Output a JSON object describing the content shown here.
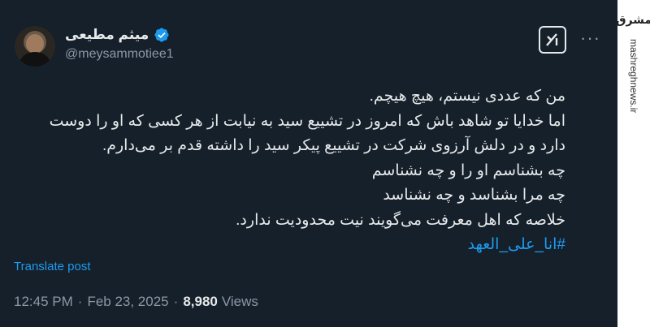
{
  "author": {
    "display_name": "میثم مطیعی",
    "handle": "@meysammotiee1"
  },
  "icons": {
    "verified": "verified-badge-icon",
    "grok": "grok-icon",
    "more": "more-options-icon",
    "avatar": "profile-avatar"
  },
  "tweet": {
    "lines": [
      "من که عددی نیستم، هیچ هیچم.",
      "اما خدایا تو شاهد باش که امروز در تشییع سید به نیابت از هر کسی که او را دوست",
      "دارد و در دلش آرزوی شرکت در تشییع پیکر سید را داشته قدم بر می‌دارم.",
      "چه بشناسم او را و چه نشناسم",
      "چه مرا بشناسد و چه نشناسد",
      "خلاصه که اهل معرفت می‌گویند نیت محدودیت ندارد."
    ],
    "hashtag": "#انا_علی_العهد"
  },
  "translate_label": "Translate post",
  "meta": {
    "time": "12:45 PM",
    "separator": "·",
    "date": "Feb 23, 2025",
    "views_count": "8,980",
    "views_label": "Views"
  },
  "watermark": {
    "logo": "مشرق",
    "site": "mashreghnews.ir"
  },
  "colors": {
    "background": "#15202b",
    "text": "#e7e9ea",
    "secondary": "#8b98a5",
    "accent": "#1d9bf0"
  }
}
